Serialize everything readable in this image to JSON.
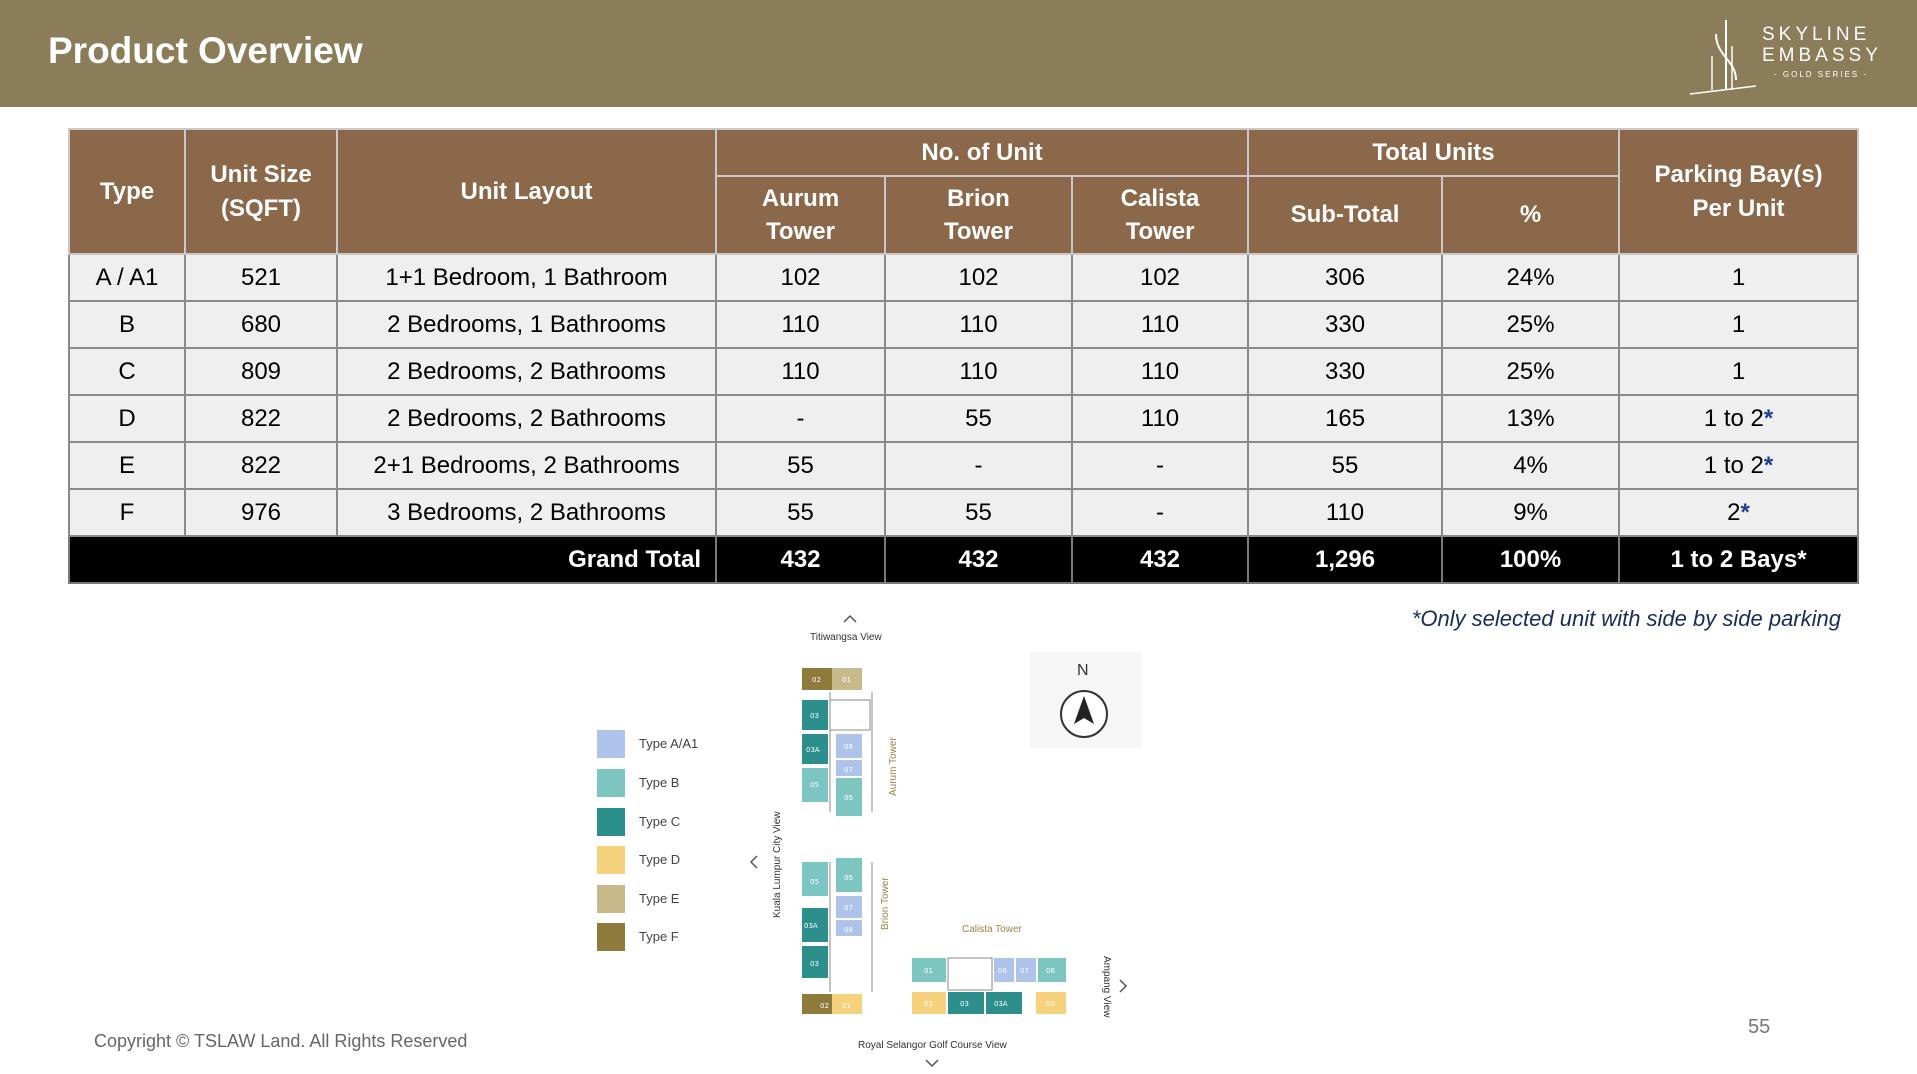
{
  "header": {
    "title": "Product Overview",
    "logo_line1": "SKYLINE",
    "logo_line2": "EMBASSY",
    "logo_sub": "- GOLD SERIES -"
  },
  "table": {
    "headers": {
      "type": "Type",
      "unit_size": "Unit Size (SQFT)",
      "unit_layout": "Unit Layout",
      "no_of_unit": "No. of Unit",
      "aurum": "Aurum Tower",
      "brion": "Brion Tower",
      "calista": "Calista Tower",
      "total_units": "Total Units",
      "sub_total": "Sub-Total",
      "percent": "%",
      "parking": "Parking Bay(s) Per Unit"
    },
    "rows": [
      {
        "type": "A / A1",
        "size": "521",
        "layout": "1+1 Bedroom, 1 Bathroom",
        "aurum": "102",
        "brion": "102",
        "calista": "102",
        "subtotal": "306",
        "pct": "24%",
        "parking": "1",
        "star": ""
      },
      {
        "type": "B",
        "size": "680",
        "layout": "2 Bedrooms, 1 Bathrooms",
        "aurum": "110",
        "brion": "110",
        "calista": "110",
        "subtotal": "330",
        "pct": "25%",
        "parking": "1",
        "star": ""
      },
      {
        "type": "C",
        "size": "809",
        "layout": "2 Bedrooms, 2 Bathrooms",
        "aurum": "110",
        "brion": "110",
        "calista": "110",
        "subtotal": "330",
        "pct": "25%",
        "parking": "1",
        "star": ""
      },
      {
        "type": "D",
        "size": "822",
        "layout": "2 Bedrooms, 2 Bathrooms",
        "aurum": "-",
        "brion": "55",
        "calista": "110",
        "subtotal": "165",
        "pct": "13%",
        "parking": "1 to 2",
        "star": "*"
      },
      {
        "type": "E",
        "size": "822",
        "layout": "2+1 Bedrooms, 2 Bathrooms",
        "aurum": "55",
        "brion": "-",
        "calista": "-",
        "subtotal": "55",
        "pct": "4%",
        "parking": "1 to 2",
        "star": "*"
      },
      {
        "type": "F",
        "size": "976",
        "layout": "3 Bedrooms, 2 Bathrooms",
        "aurum": "55",
        "brion": "55",
        "calista": "-",
        "subtotal": "110",
        "pct": "9%",
        "parking": "2",
        "star": "*"
      }
    ],
    "total": {
      "label": "Grand Total",
      "aurum": "432",
      "brion": "432",
      "calista": "432",
      "subtotal": "1,296",
      "pct": "100%",
      "parking": "1 to 2 Bays*"
    }
  },
  "note": "*Only selected unit with side by side parking",
  "legend": [
    {
      "label": "Type A/A1",
      "color": "#adc3ec"
    },
    {
      "label": "Type B",
      "color": "#7cc5c1"
    },
    {
      "label": "Type C",
      "color": "#2d8f8b"
    },
    {
      "label": "Type D",
      "color": "#f7d27c"
    },
    {
      "label": "Type E",
      "color": "#c8b98b"
    },
    {
      "label": "Type F",
      "color": "#8e7a3a"
    }
  ],
  "siteplan": {
    "north_view": "Titiwangsa View",
    "west_view": "Kuala Lumpur City View",
    "east_view": "Ampang View",
    "south_view": "Royal Selangor Golf Course View",
    "aurum_label": "Aurum Tower",
    "brion_label": "Brion Tower",
    "calista_label": "Calista Tower",
    "compass_letter": "N"
  },
  "footer": {
    "copyright": "Copyright © TSLAW Land. All Rights Reserved",
    "page_number": "55"
  }
}
